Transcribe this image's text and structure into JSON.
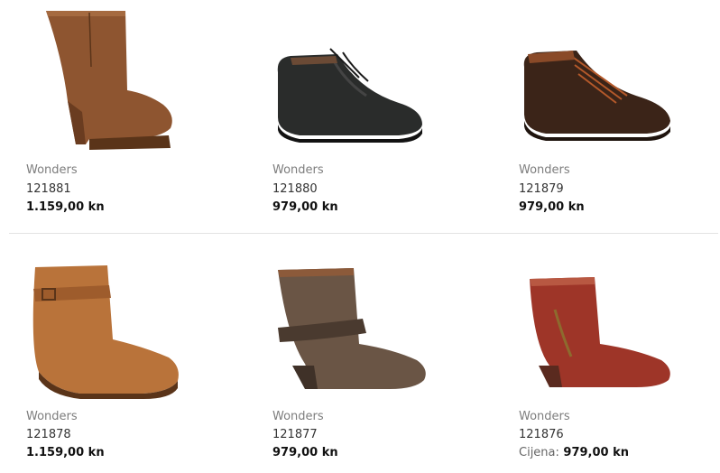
{
  "products": [
    {
      "brand": "Wonders",
      "code": "121881",
      "price": "1.159,00 kn",
      "price_label": "",
      "color": "#8e5530",
      "image": "tall-heel-boot"
    },
    {
      "brand": "Wonders",
      "code": "121880",
      "price": "979,00 kn",
      "price_label": "",
      "color": "#2a2c2b",
      "image": "lace-up-ankle-boot"
    },
    {
      "brand": "Wonders",
      "code": "121879",
      "price": "979,00 kn",
      "price_label": "",
      "color": "#3b2418",
      "image": "lace-up-ankle-boot"
    },
    {
      "brand": "Wonders",
      "code": "121878",
      "price": "1.159,00 kn",
      "price_label": "",
      "color": "#b9733a",
      "image": "wedge-strap-boot"
    },
    {
      "brand": "Wonders",
      "code": "121877",
      "price": "979,00 kn",
      "price_label": "",
      "color": "#6a5545",
      "image": "strap-heel-boot"
    },
    {
      "brand": "Wonders",
      "code": "121876",
      "price": "979,00 kn",
      "price_label": "Cijena:",
      "color": "#9e3528",
      "image": "zip-heel-boot"
    }
  ]
}
